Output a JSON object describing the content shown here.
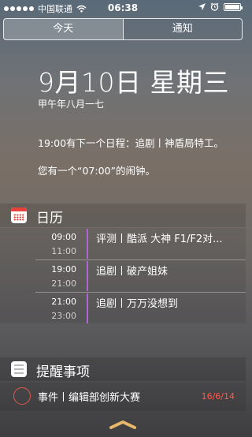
{
  "status_bar": {
    "carrier": "中国联通",
    "time": "06:38"
  },
  "tabs": [
    {
      "label": "今天",
      "active": true
    },
    {
      "label": "通知",
      "active": false
    }
  ],
  "today": {
    "date": "9月10日 星期三",
    "lunar": "甲午年八月一七",
    "next_event": "19:00有下一个日程：追剧丨神盾局特工。",
    "alarm": "您有一个“07:00”的闹钟。"
  },
  "calendar": {
    "title": "日历",
    "accent_color": "#b066d6",
    "events": [
      {
        "start": "09:00",
        "end": "11:00",
        "title": "评测丨酷派 大神 F1/F2对..."
      },
      {
        "start": "19:00",
        "end": "21:00",
        "title": "追剧丨破产姐妹"
      },
      {
        "start": "21:00",
        "end": "23:00",
        "title": "追剧丨万万没想到"
      }
    ]
  },
  "reminders": {
    "title": "提醒事项",
    "items": [
      {
        "title": "事件丨编辑部创新大赛",
        "date": "16/6/14",
        "date_color": "#ff5a4a"
      }
    ]
  },
  "icons": {
    "signal": "signal-dots-icon",
    "wifi": "wifi-icon",
    "location": "location-arrow-icon",
    "alarm": "alarm-clock-icon",
    "battery": "battery-icon",
    "calendar": "calendar-icon",
    "reminders": "reminders-icon",
    "grabber": "chevron-up-grabber-icon"
  }
}
